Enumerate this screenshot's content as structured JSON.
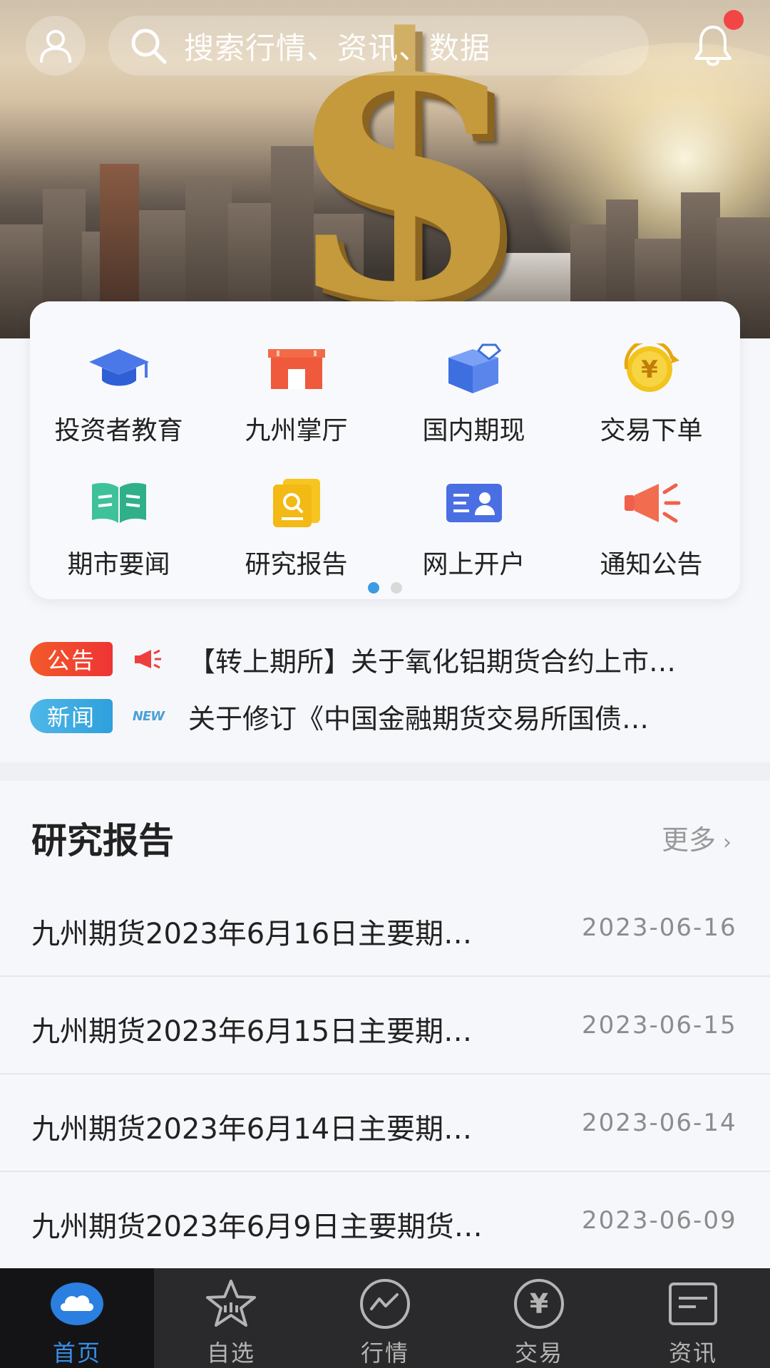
{
  "header": {
    "search_placeholder": "搜索行情、资讯、数据",
    "has_unread": true
  },
  "banner": {
    "symbol": "$"
  },
  "quick_menu": {
    "items": [
      {
        "label": "投资者教育",
        "icon": "graduation-cap-icon"
      },
      {
        "label": "九州掌厅",
        "icon": "storefront-icon"
      },
      {
        "label": "国内期现",
        "icon": "box-diamond-icon"
      },
      {
        "label": "交易下单",
        "icon": "yen-coin-icon"
      },
      {
        "label": "期市要闻",
        "icon": "open-book-icon"
      },
      {
        "label": "研究报告",
        "icon": "report-search-icon"
      },
      {
        "label": "网上开户",
        "icon": "id-card-icon"
      },
      {
        "label": "通知公告",
        "icon": "megaphone-icon"
      }
    ],
    "page_count": 2,
    "current_page": 1
  },
  "notices": [
    {
      "tag": "公告",
      "icon": "megaphone-icon",
      "text": "【转上期所】关于氧化铝期货合约上市…"
    },
    {
      "tag": "新闻",
      "icon": "new-badge-icon",
      "badge": "NEW",
      "text": "关于修订《中国金融期货交易所国债…"
    }
  ],
  "reports": {
    "title": "研究报告",
    "more_label": "更多",
    "items": [
      {
        "title": "九州期货2023年6月16日主要期…",
        "date": "2023-06-16"
      },
      {
        "title": "九州期货2023年6月15日主要期…",
        "date": "2023-06-15"
      },
      {
        "title": "九州期货2023年6月14日主要期…",
        "date": "2023-06-14"
      },
      {
        "title": "九州期货2023年6月9日主要期货…",
        "date": "2023-06-09"
      }
    ]
  },
  "tabbar": {
    "items": [
      {
        "label": "首页",
        "icon": "home-icon",
        "active": true
      },
      {
        "label": "自选",
        "icon": "star-icon",
        "active": false
      },
      {
        "label": "行情",
        "icon": "market-chart-icon",
        "active": false
      },
      {
        "label": "交易",
        "icon": "yen-icon",
        "active": false
      },
      {
        "label": "资讯",
        "icon": "news-icon",
        "active": false
      }
    ]
  },
  "colors": {
    "accent": "#3a8fe6",
    "notice_tag_red": "#f04a2e",
    "notice_tag_blue": "#36a6e0",
    "tabbar_bg": "#2a2a2c"
  }
}
